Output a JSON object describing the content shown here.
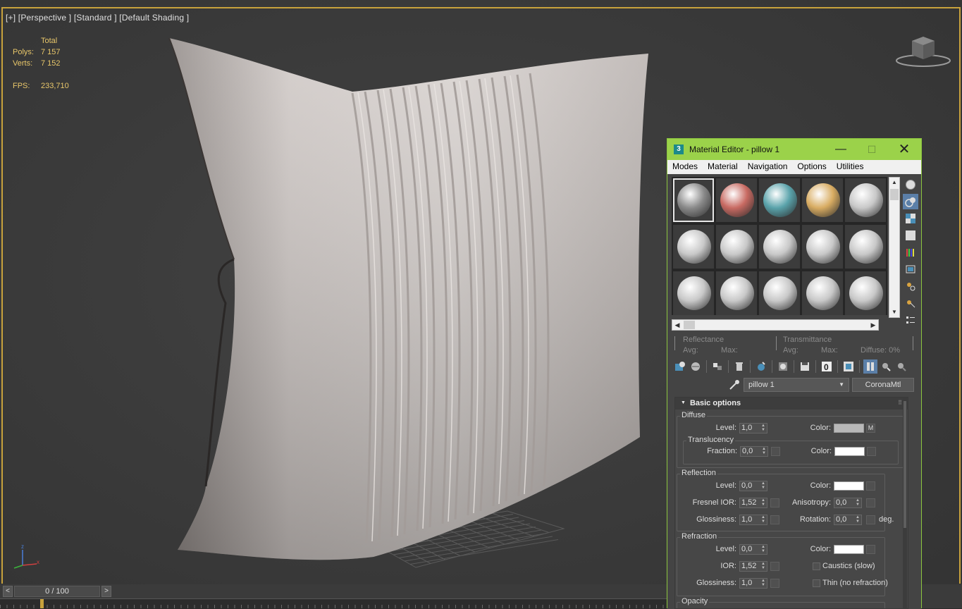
{
  "viewport": {
    "label": "[+] [Perspective ] [Standard ] [Default Shading ]",
    "stats": {
      "header": "Total",
      "polys_label": "Polys:",
      "polys_value": "7 157",
      "verts_label": "Verts:",
      "verts_value": "7 152",
      "fps_label": "FPS:",
      "fps_value": "233,710"
    }
  },
  "timeline": {
    "prev": "<",
    "next": ">",
    "frame": "0 / 100"
  },
  "material_editor": {
    "title": "Material Editor - pillow 1",
    "app_icon": "3",
    "window_buttons": {
      "minimize": "—",
      "maximize": "☐",
      "close": "✕"
    },
    "menu": [
      "Modes",
      "Material",
      "Navigation",
      "Options",
      "Utilities"
    ],
    "slots": [
      {
        "color": "#8a8a8a",
        "icon": "wood-gray-sphere"
      },
      {
        "color": "#c86a62",
        "icon": "wood-red-sphere"
      },
      {
        "color": "#5aa3ab",
        "icon": "teal-sphere"
      },
      {
        "color": "#d8ac62",
        "icon": "tan-sphere"
      },
      {
        "color": "#c8c8c8",
        "icon": "gray-sphere"
      },
      {
        "color": "#c8c8c8",
        "icon": "gray-sphere"
      },
      {
        "color": "#c8c8c8",
        "icon": "gray-sphere"
      },
      {
        "color": "#c8c8c8",
        "icon": "gray-sphere"
      },
      {
        "color": "#c8c8c8",
        "icon": "gray-sphere"
      },
      {
        "color": "#c8c8c8",
        "icon": "gray-sphere"
      },
      {
        "color": "#c8c8c8",
        "icon": "gray-sphere"
      },
      {
        "color": "#c8c8c8",
        "icon": "gray-sphere"
      },
      {
        "color": "#c8c8c8",
        "icon": "gray-sphere"
      },
      {
        "color": "#c8c8c8",
        "icon": "gray-sphere"
      },
      {
        "color": "#c8c8c8",
        "icon": "gray-sphere"
      }
    ],
    "reflectance": {
      "reflectance_label": "Reflectance",
      "transmittance_label": "Transmittance",
      "avg1": "Avg:",
      "max1": "Max:",
      "avg2": "Avg:",
      "max2": "Max:",
      "diffuse": "Diffuse:  0%"
    },
    "material_name": "pillow 1",
    "material_type": "CoronaMtl",
    "rollout_title": "Basic options",
    "diffuse": {
      "title": "Diffuse",
      "level_label": "Level:",
      "level": "1,0",
      "color_label": "Color:",
      "color": "#b8b8b8",
      "map_label": "M",
      "translucency": {
        "title": "Translucency",
        "fraction_label": "Fraction:",
        "fraction": "0,0",
        "color_label": "Color:",
        "color": "#ffffff"
      }
    },
    "reflection": {
      "title": "Reflection",
      "level_label": "Level:",
      "level": "0,0",
      "color_label": "Color:",
      "color": "#ffffff",
      "ior_label": "Fresnel IOR:",
      "ior": "1,52",
      "aniso_label": "Anisotropy:",
      "aniso": "0,0",
      "gloss_label": "Glossiness:",
      "gloss": "1,0",
      "rot_label": "Rotation:",
      "rot": "0,0",
      "deg": "deg."
    },
    "refraction": {
      "title": "Refraction",
      "level_label": "Level:",
      "level": "0,0",
      "color_label": "Color:",
      "color": "#ffffff",
      "ior_label": "IOR:",
      "ior": "1,52",
      "caustics_label": "Caustics (slow)",
      "gloss_label": "Glossiness:",
      "gloss": "1,0",
      "thin_label": "Thin (no refraction)"
    },
    "opacity": {
      "title": "Opacity"
    }
  }
}
